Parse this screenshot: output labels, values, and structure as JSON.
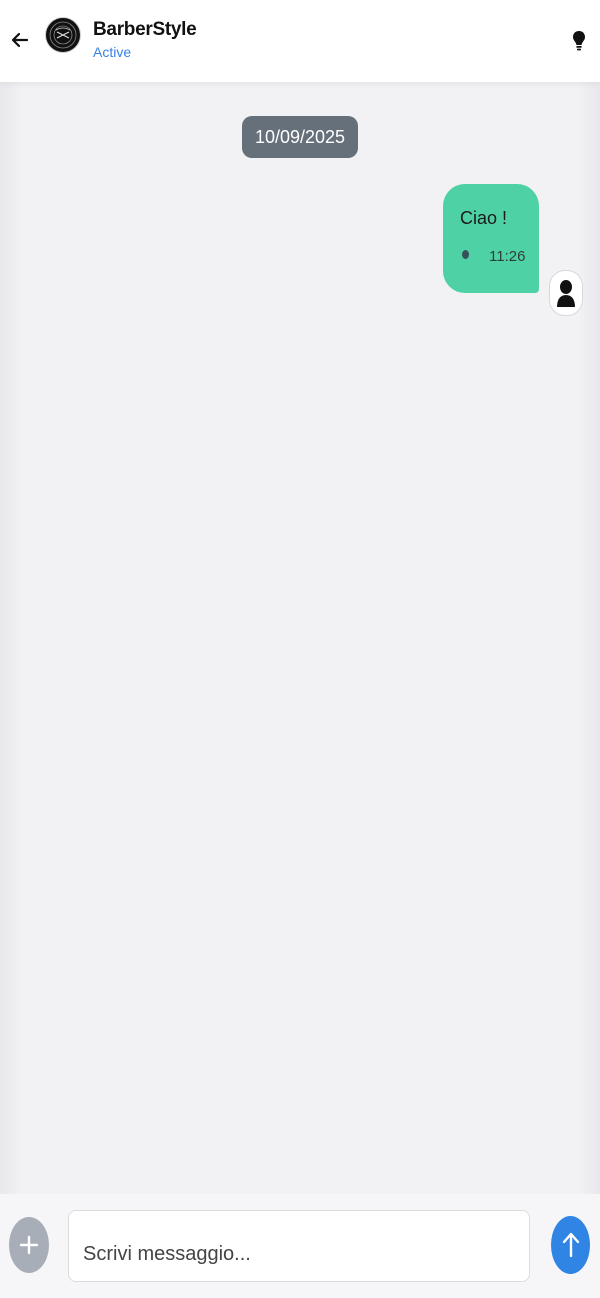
{
  "header": {
    "title": "BarberStyle",
    "status": "Active",
    "icons": {
      "back": "arrow-left-icon",
      "avatar": "barber-logo",
      "menu": "lightbulb-icon"
    }
  },
  "chat": {
    "date": "10/09/2025",
    "messages": [
      {
        "text": "Ciao !",
        "time": "11:26",
        "sender": "me"
      }
    ]
  },
  "composer": {
    "placeholder": "Scrivi messaggio..."
  },
  "colors": {
    "accent": "#3b82e6",
    "bubble": "#4fd1a6",
    "date_pill": "#66707a",
    "send_button": "#2f84e4",
    "plus_button": "#a8aeb8"
  }
}
